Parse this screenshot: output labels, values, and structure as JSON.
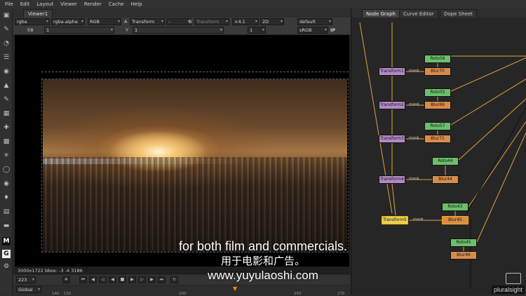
{
  "menu": [
    "File",
    "Edit",
    "Layout",
    "Viewer",
    "Render",
    "Cache",
    "Help"
  ],
  "viewer": {
    "tab_label": "Viewer1",
    "row1": {
      "channels": "rgba",
      "alpha": "rgba.alpha",
      "color": "RGB",
      "a_label": "A",
      "a_input": "Transform",
      "a_op": "-",
      "b_label": "B",
      "b_input": "Transform",
      "zoom": "×4.1",
      "view_mode": "2D",
      "lut": "default"
    },
    "row2": {
      "fstop": "f/8",
      "gain": "1",
      "y_label": "Y",
      "gamma": "1",
      "proxy": "1",
      "colorspace": "sRGB",
      "ip": "IP"
    },
    "status_text": "3000x1722 bbox: -3 -4 3186",
    "frame": "223",
    "scope": "Global",
    "ruler_ticks": [
      "140",
      "150",
      "200",
      "250",
      "270"
    ]
  },
  "node_graph": {
    "tabs": [
      "Node Graph",
      "Curve Editor",
      "Dope Sheet"
    ],
    "nodes": {
      "roto": [
        "Roto56",
        "Roto55",
        "Roto57",
        "Roto44",
        "Roto43",
        "Roto45"
      ],
      "blur": [
        "Blur70",
        "Blur69",
        "Blur71",
        "Blur44",
        "Blur45",
        "Blur46"
      ],
      "transform": [
        "Transform1",
        "Transform2",
        "Transform3",
        "Transform4",
        "Transform5"
      ]
    },
    "mask_label": "mask"
  },
  "subtitles": {
    "english": "for both film and commercials.",
    "chinese": "用于电影和广告。",
    "url": "www.yuyulaoshi.com"
  },
  "watermark": "pluralsight",
  "colors": {
    "roto": "#6bbf6b",
    "blur": "#d98b4c",
    "transform": "#b38ac4",
    "selected": "#e8d05a",
    "edge": "#e0a040"
  }
}
